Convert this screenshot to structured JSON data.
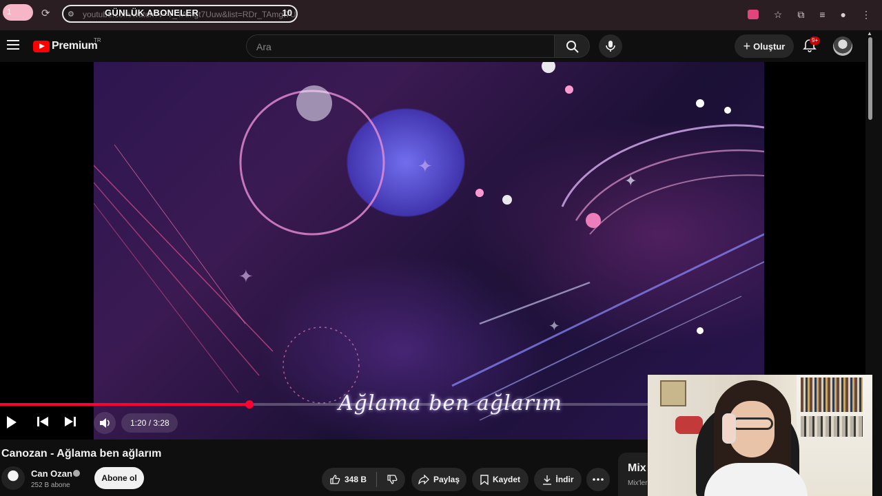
{
  "browser": {
    "tab_badge": "1",
    "url": "youtube.com/watch?v=T_TAmgt7Uuw&list=RDr_TAmgt7Uuw",
    "overlay_title": "GÜNLÜK ABONELER",
    "overlay_count": "10"
  },
  "header": {
    "logo_text": "Premium",
    "country": "TR",
    "search_placeholder": "Ara",
    "create_label": "Oluştur",
    "notifications_badge": "9+"
  },
  "player": {
    "lyric": "Ağlama ben ağlarım",
    "time": "1:20 / 3:28",
    "progress_fraction": 0.385
  },
  "video": {
    "title": "Canozan - Ağlama ben ağlarım",
    "channel": "Can Ozan",
    "subscribers": "252 B abone",
    "subscribe_label": "Abone ol",
    "likes": "348 B",
    "share_label": "Paylaş",
    "save_label": "Kaydet",
    "download_label": "İndir"
  },
  "sidebar": {
    "mix_title": "Mix",
    "mix_sub": "Mix'ler"
  },
  "colors": {
    "accent": "#ff0033",
    "background": "#0f0f0f",
    "chip": "#272727"
  }
}
